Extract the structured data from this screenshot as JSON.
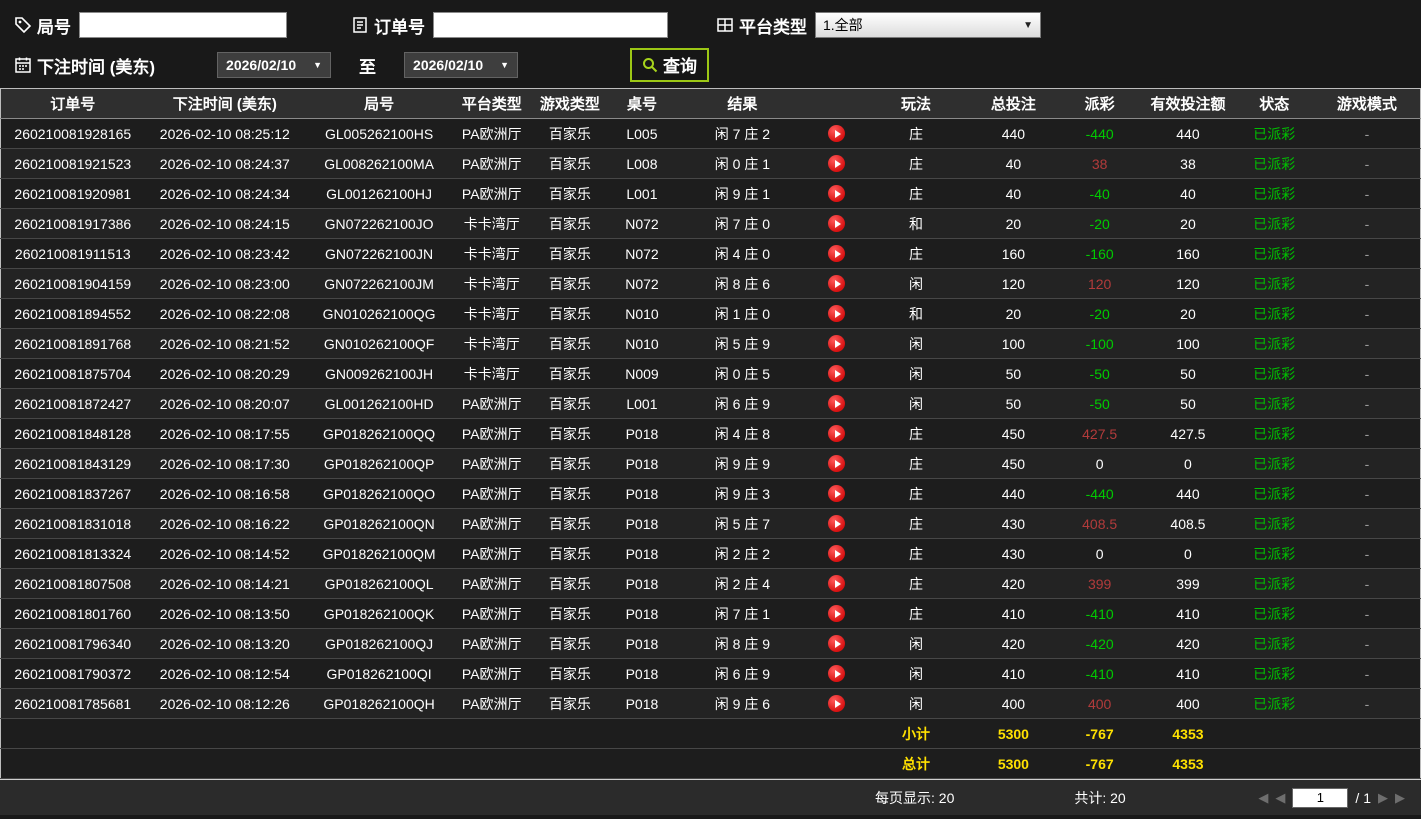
{
  "toolbar": {
    "round_label": "局号",
    "round_value": "",
    "order_label": "订单号",
    "order_value": "",
    "platform_label": "平台类型",
    "platform_value": "1.全部",
    "bet_time_label": "下注时间 (美东)",
    "date_from": "2026/02/10",
    "to_label": "至",
    "date_to": "2026/02/10",
    "search_label": "查询"
  },
  "table": {
    "columns": [
      "订单号",
      "下注时间 (美东)",
      "局号",
      "平台类型",
      "游戏类型",
      "桌号",
      "结果",
      "",
      "玩法",
      "总投注",
      "派彩",
      "有效投注额",
      "状态",
      "游戏模式"
    ],
    "rows": [
      {
        "order_id": "260210081928165",
        "bet_time": "2026-02-10 08:25:12",
        "round_id": "GL005262100HS",
        "platform": "PA欧洲厅",
        "game_type": "百家乐",
        "table_no": "L005",
        "result": "闲 7 庄 2",
        "bet_type": "庄",
        "total_bet": "440",
        "payout": "-440",
        "payout_color": "green",
        "valid_bet": "440",
        "status": "已派彩",
        "game_mode": "-"
      },
      {
        "order_id": "260210081921523",
        "bet_time": "2026-02-10 08:24:37",
        "round_id": "GL008262100MA",
        "platform": "PA欧洲厅",
        "game_type": "百家乐",
        "table_no": "L008",
        "result": "闲 0 庄 1",
        "bet_type": "庄",
        "total_bet": "40",
        "payout": "38",
        "payout_color": "red",
        "valid_bet": "38",
        "status": "已派彩",
        "game_mode": "-"
      },
      {
        "order_id": "260210081920981",
        "bet_time": "2026-02-10 08:24:34",
        "round_id": "GL001262100HJ",
        "platform": "PA欧洲厅",
        "game_type": "百家乐",
        "table_no": "L001",
        "result": "闲 9 庄 1",
        "bet_type": "庄",
        "total_bet": "40",
        "payout": "-40",
        "payout_color": "green",
        "valid_bet": "40",
        "status": "已派彩",
        "game_mode": "-"
      },
      {
        "order_id": "260210081917386",
        "bet_time": "2026-02-10 08:24:15",
        "round_id": "GN072262100JO",
        "platform": "卡卡湾厅",
        "game_type": "百家乐",
        "table_no": "N072",
        "result": "闲 7 庄 0",
        "bet_type": "和",
        "total_bet": "20",
        "payout": "-20",
        "payout_color": "green",
        "valid_bet": "20",
        "status": "已派彩",
        "game_mode": "-"
      },
      {
        "order_id": "260210081911513",
        "bet_time": "2026-02-10 08:23:42",
        "round_id": "GN072262100JN",
        "platform": "卡卡湾厅",
        "game_type": "百家乐",
        "table_no": "N072",
        "result": "闲 4 庄 0",
        "bet_type": "庄",
        "total_bet": "160",
        "payout": "-160",
        "payout_color": "green",
        "valid_bet": "160",
        "status": "已派彩",
        "game_mode": "-"
      },
      {
        "order_id": "260210081904159",
        "bet_time": "2026-02-10 08:23:00",
        "round_id": "GN072262100JM",
        "platform": "卡卡湾厅",
        "game_type": "百家乐",
        "table_no": "N072",
        "result": "闲 8 庄 6",
        "bet_type": "闲",
        "total_bet": "120",
        "payout": "120",
        "payout_color": "red",
        "valid_bet": "120",
        "status": "已派彩",
        "game_mode": "-"
      },
      {
        "order_id": "260210081894552",
        "bet_time": "2026-02-10 08:22:08",
        "round_id": "GN010262100QG",
        "platform": "卡卡湾厅",
        "game_type": "百家乐",
        "table_no": "N010",
        "result": "闲 1 庄 0",
        "bet_type": "和",
        "total_bet": "20",
        "payout": "-20",
        "payout_color": "green",
        "valid_bet": "20",
        "status": "已派彩",
        "game_mode": "-"
      },
      {
        "order_id": "260210081891768",
        "bet_time": "2026-02-10 08:21:52",
        "round_id": "GN010262100QF",
        "platform": "卡卡湾厅",
        "game_type": "百家乐",
        "table_no": "N010",
        "result": "闲 5 庄 9",
        "bet_type": "闲",
        "total_bet": "100",
        "payout": "-100",
        "payout_color": "green",
        "valid_bet": "100",
        "status": "已派彩",
        "game_mode": "-"
      },
      {
        "order_id": "260210081875704",
        "bet_time": "2026-02-10 08:20:29",
        "round_id": "GN009262100JH",
        "platform": "卡卡湾厅",
        "game_type": "百家乐",
        "table_no": "N009",
        "result": "闲 0 庄 5",
        "bet_type": "闲",
        "total_bet": "50",
        "payout": "-50",
        "payout_color": "green",
        "valid_bet": "50",
        "status": "已派彩",
        "game_mode": "-"
      },
      {
        "order_id": "260210081872427",
        "bet_time": "2026-02-10 08:20:07",
        "round_id": "GL001262100HD",
        "platform": "PA欧洲厅",
        "game_type": "百家乐",
        "table_no": "L001",
        "result": "闲 6 庄 9",
        "bet_type": "闲",
        "total_bet": "50",
        "payout": "-50",
        "payout_color": "green",
        "valid_bet": "50",
        "status": "已派彩",
        "game_mode": "-"
      },
      {
        "order_id": "260210081848128",
        "bet_time": "2026-02-10 08:17:55",
        "round_id": "GP018262100QQ",
        "platform": "PA欧洲厅",
        "game_type": "百家乐",
        "table_no": "P018",
        "result": "闲 4 庄 8",
        "bet_type": "庄",
        "total_bet": "450",
        "payout": "427.5",
        "payout_color": "red",
        "valid_bet": "427.5",
        "status": "已派彩",
        "game_mode": "-"
      },
      {
        "order_id": "260210081843129",
        "bet_time": "2026-02-10 08:17:30",
        "round_id": "GP018262100QP",
        "platform": "PA欧洲厅",
        "game_type": "百家乐",
        "table_no": "P018",
        "result": "闲 9 庄 9",
        "bet_type": "庄",
        "total_bet": "450",
        "payout": "0",
        "payout_color": "white",
        "valid_bet": "0",
        "status": "已派彩",
        "game_mode": "-"
      },
      {
        "order_id": "260210081837267",
        "bet_time": "2026-02-10 08:16:58",
        "round_id": "GP018262100QO",
        "platform": "PA欧洲厅",
        "game_type": "百家乐",
        "table_no": "P018",
        "result": "闲 9 庄 3",
        "bet_type": "庄",
        "total_bet": "440",
        "payout": "-440",
        "payout_color": "green",
        "valid_bet": "440",
        "status": "已派彩",
        "game_mode": "-"
      },
      {
        "order_id": "260210081831018",
        "bet_time": "2026-02-10 08:16:22",
        "round_id": "GP018262100QN",
        "platform": "PA欧洲厅",
        "game_type": "百家乐",
        "table_no": "P018",
        "result": "闲 5 庄 7",
        "bet_type": "庄",
        "total_bet": "430",
        "payout": "408.5",
        "payout_color": "red",
        "valid_bet": "408.5",
        "status": "已派彩",
        "game_mode": "-"
      },
      {
        "order_id": "260210081813324",
        "bet_time": "2026-02-10 08:14:52",
        "round_id": "GP018262100QM",
        "platform": "PA欧洲厅",
        "game_type": "百家乐",
        "table_no": "P018",
        "result": "闲 2 庄 2",
        "bet_type": "庄",
        "total_bet": "430",
        "payout": "0",
        "payout_color": "white",
        "valid_bet": "0",
        "status": "已派彩",
        "game_mode": "-"
      },
      {
        "order_id": "260210081807508",
        "bet_time": "2026-02-10 08:14:21",
        "round_id": "GP018262100QL",
        "platform": "PA欧洲厅",
        "game_type": "百家乐",
        "table_no": "P018",
        "result": "闲 2 庄 4",
        "bet_type": "庄",
        "total_bet": "420",
        "payout": "399",
        "payout_color": "red",
        "valid_bet": "399",
        "status": "已派彩",
        "game_mode": "-"
      },
      {
        "order_id": "260210081801760",
        "bet_time": "2026-02-10 08:13:50",
        "round_id": "GP018262100QK",
        "platform": "PA欧洲厅",
        "game_type": "百家乐",
        "table_no": "P018",
        "result": "闲 7 庄 1",
        "bet_type": "庄",
        "total_bet": "410",
        "payout": "-410",
        "payout_color": "green",
        "valid_bet": "410",
        "status": "已派彩",
        "game_mode": "-"
      },
      {
        "order_id": "260210081796340",
        "bet_time": "2026-02-10 08:13:20",
        "round_id": "GP018262100QJ",
        "platform": "PA欧洲厅",
        "game_type": "百家乐",
        "table_no": "P018",
        "result": "闲 8 庄 9",
        "bet_type": "闲",
        "total_bet": "420",
        "payout": "-420",
        "payout_color": "green",
        "valid_bet": "420",
        "status": "已派彩",
        "game_mode": "-"
      },
      {
        "order_id": "260210081790372",
        "bet_time": "2026-02-10 08:12:54",
        "round_id": "GP018262100QI",
        "platform": "PA欧洲厅",
        "game_type": "百家乐",
        "table_no": "P018",
        "result": "闲 6 庄 9",
        "bet_type": "闲",
        "total_bet": "410",
        "payout": "-410",
        "payout_color": "green",
        "valid_bet": "410",
        "status": "已派彩",
        "game_mode": "-"
      },
      {
        "order_id": "260210081785681",
        "bet_time": "2026-02-10 08:12:26",
        "round_id": "GP018262100QH",
        "platform": "PA欧洲厅",
        "game_type": "百家乐",
        "table_no": "P018",
        "result": "闲 9 庄 6",
        "bet_type": "闲",
        "total_bet": "400",
        "payout": "400",
        "payout_color": "red",
        "valid_bet": "400",
        "status": "已派彩",
        "game_mode": "-"
      }
    ],
    "subtotal": {
      "label": "小计",
      "total_bet": "5300",
      "payout": "-767",
      "valid_bet": "4353"
    },
    "total": {
      "label": "总计",
      "total_bet": "5300",
      "payout": "-767",
      "valid_bet": "4353"
    }
  },
  "footer": {
    "per_page_label": "每页显示: 20",
    "total_count_label": "共计: 20",
    "page_value": "1",
    "page_total": "/ 1"
  },
  "colors": {
    "payout_negative": "#00cc00",
    "payout_positive": "#b23b3b",
    "status_paid": "#00c000",
    "summary_text": "#ffe100",
    "search_border": "#9cc715",
    "play_button": "#d81212"
  }
}
